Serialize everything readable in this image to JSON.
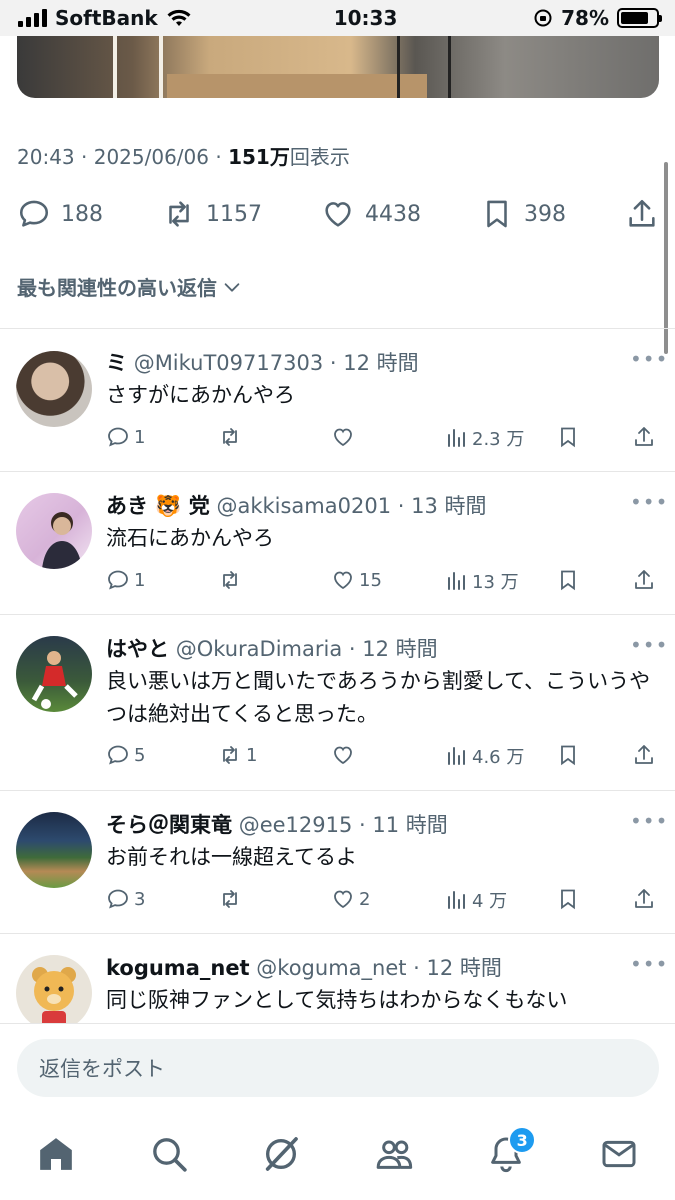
{
  "status_bar": {
    "carrier": "SoftBank",
    "time": "10:33",
    "battery": "78%",
    "battery_level": 0.78
  },
  "tweet": {
    "time": "20:43",
    "date": "2025/06/06",
    "views_count": "151万",
    "views_suffix": "回表示",
    "replies": "188",
    "retweets": "1157",
    "likes": "4438",
    "bookmarks": "398"
  },
  "sort_label": "最も関連性の高い返信",
  "replies": [
    {
      "name": "ミ",
      "handle": "@MikuT09717303",
      "time": "12 時間",
      "text": "さすがにあかんやろ",
      "comments": "1",
      "retweets": "",
      "likes": "",
      "views": "2.3 万"
    },
    {
      "name": "あき 🐯 党",
      "handle": "@akkisama0201",
      "time": "13 時間",
      "text": "流石にあかんやろ",
      "comments": "1",
      "retweets": "",
      "likes": "15",
      "views": "13 万"
    },
    {
      "name": "はやと",
      "handle": "@OkuraDimaria",
      "time": "12 時間",
      "text": "良い悪いは万と聞いたであろうから割愛して、こういうやつは絶対出てくると思った。",
      "comments": "5",
      "retweets": "1",
      "likes": "",
      "views": "4.6 万"
    },
    {
      "name": "そら＠関東竜",
      "handle": "@ee12915",
      "time": "11 時間",
      "text": "お前それは一線超えてるよ",
      "comments": "3",
      "retweets": "",
      "likes": "2",
      "views": "4 万"
    },
    {
      "name": "koguma_net",
      "handle": "@koguma_net",
      "time": "12 時間",
      "text": "同じ阪神ファンとして気持ちはわからなくもない",
      "comments": "",
      "retweets": "",
      "likes": "",
      "views": ""
    }
  ],
  "reply_box": {
    "placeholder": "返信をポスト"
  },
  "nav": {
    "notifications_badge": "3"
  },
  "colors": {
    "accent": "#1d9bf0",
    "secondary_text": "#536471",
    "primary_text": "#0f1419"
  },
  "icons": [
    "comment-icon",
    "retweet-icon",
    "heart-icon",
    "bookmark-icon",
    "share-icon",
    "views-icon",
    "chevron-down-icon",
    "more-icon",
    "home-icon",
    "search-icon",
    "grok-icon",
    "communities-icon",
    "bell-icon",
    "mail-icon"
  ]
}
